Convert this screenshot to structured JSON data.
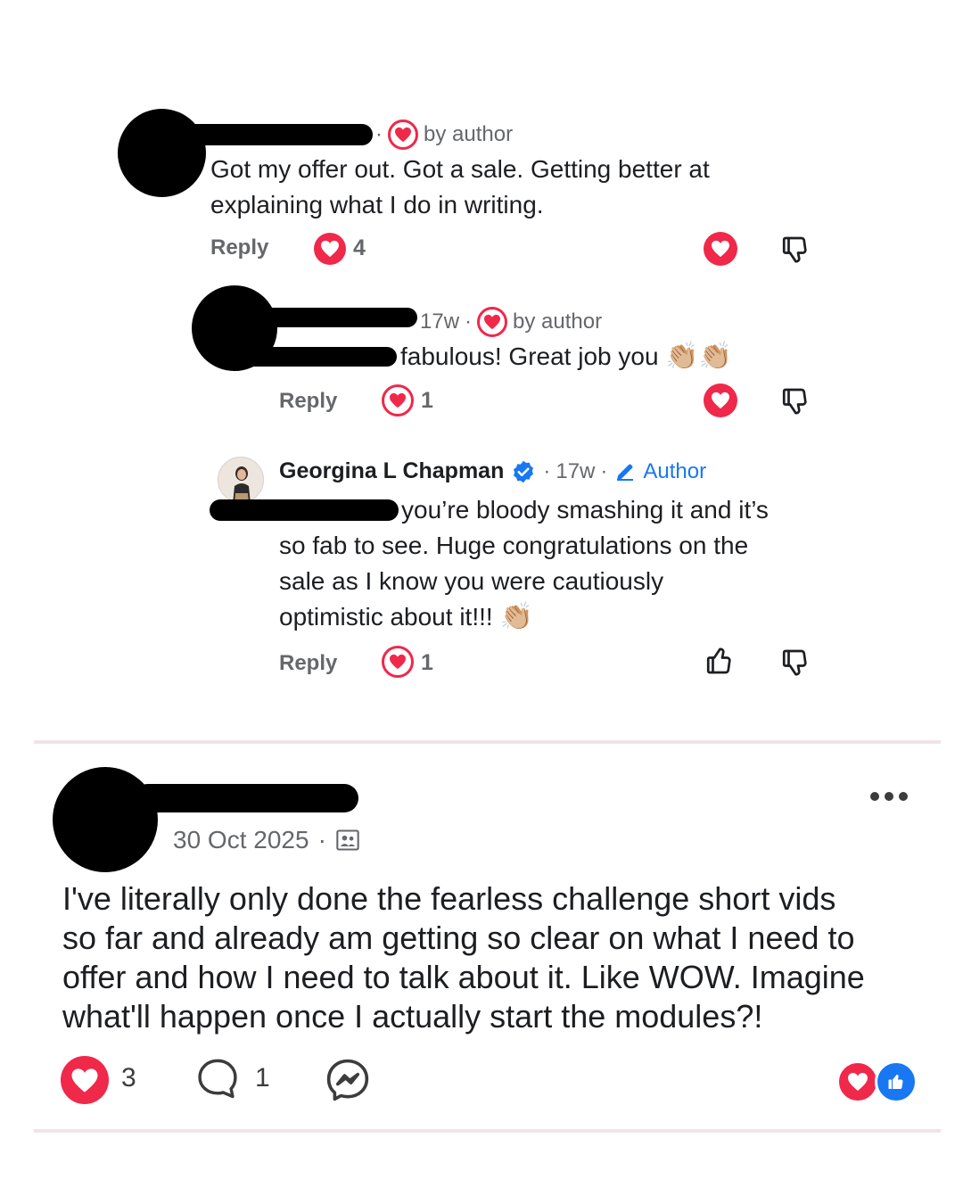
{
  "comment1": {
    "by_author": "by author",
    "text_line1": "Got my offer out. Got a sale. Getting better at",
    "text_line2": "explaining what I do in writing.",
    "reply_label": "Reply",
    "reaction_count": "4"
  },
  "comment2": {
    "time": "17w",
    "by_author": "by author",
    "text": "fabulous! Great job you",
    "emoji": "👏🏼👏🏼",
    "reply_label": "Reply",
    "reaction_count": "1"
  },
  "comment3": {
    "author_name": "Georgina L Chapman",
    "time": "17w",
    "author_badge": "Author",
    "text_line1": "you’re bloody smashing it and it’s",
    "text_line2": "so fab to see. Huge congratulations on the",
    "text_line3": "sale as I know you were cautiously",
    "text_line4": "optimistic about it!!!",
    "emoji": "👏🏼",
    "reply_label": "Reply",
    "reaction_count": "1"
  },
  "post": {
    "date": "30 Oct 2025",
    "text_line1": "I've literally only done the fearless challenge short vids",
    "text_line2": "so far and already am getting so clear on what I need to",
    "text_line3": "offer and how I need to talk about it. Like WOW. Imagine",
    "text_line4": "what'll happen once I actually start the modules?!",
    "reaction_count": "3",
    "comment_count": "1"
  },
  "colors": {
    "heart_red": "#f0284a",
    "verified_blue": "#1877f2",
    "meta_gray": "#65676b"
  },
  "icons": [
    "heart-icon",
    "dislike-icon",
    "like-icon",
    "verified-icon",
    "pencil-icon",
    "group-icon",
    "more-icon",
    "comment-icon",
    "messenger-icon"
  ]
}
